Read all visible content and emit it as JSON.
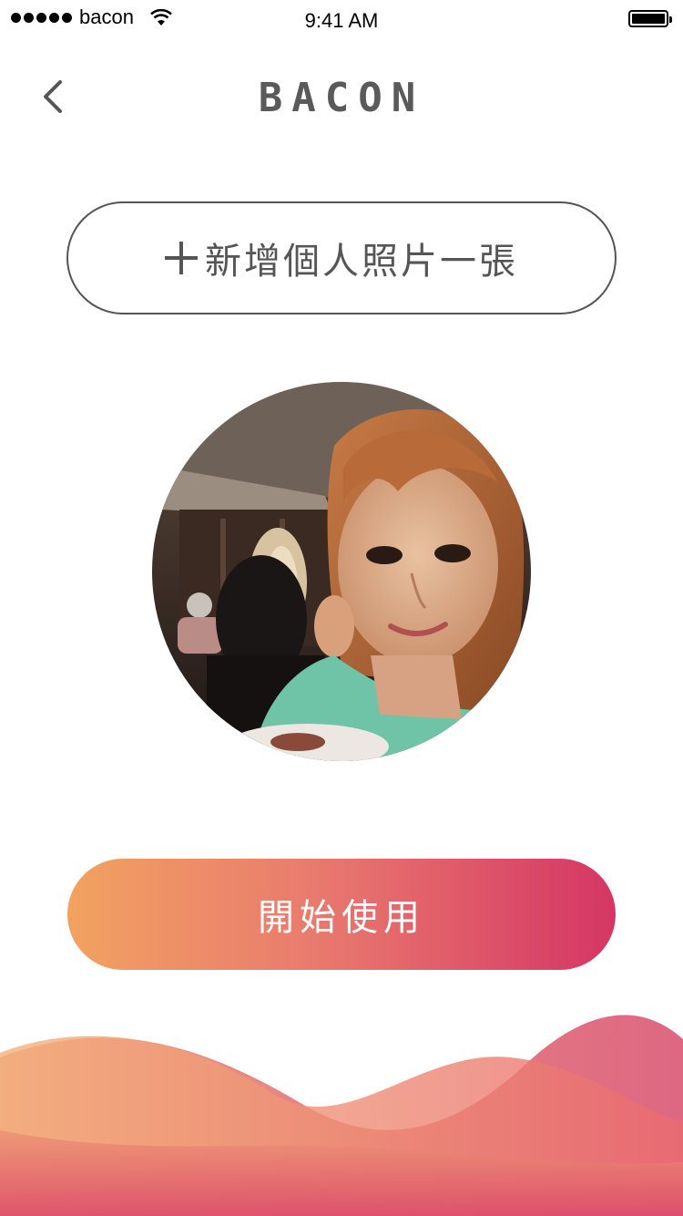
{
  "status_bar": {
    "carrier": "bacon",
    "time": "9:41 AM"
  },
  "nav": {
    "logo": "BACON",
    "back_icon": "chevron-left-icon"
  },
  "add_photo": {
    "label": "新增個人照片一張",
    "icon": "plus-icon"
  },
  "profile_photo": {
    "alt": "profile photo"
  },
  "start": {
    "label": "開始使用"
  },
  "colors": {
    "text": "#555555",
    "gradient_start": "#f2a260",
    "gradient_end": "#d53664"
  }
}
